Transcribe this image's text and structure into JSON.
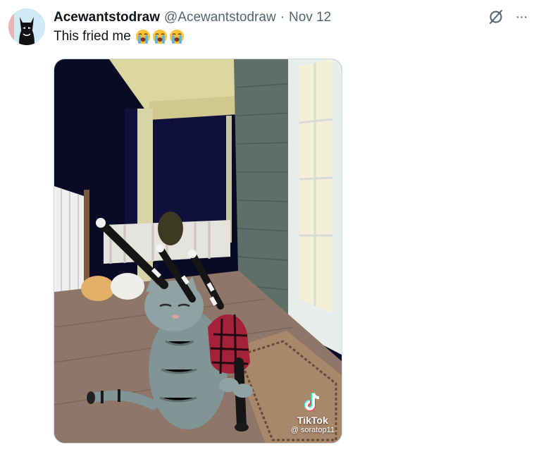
{
  "post": {
    "display_name": "Acewantstodraw",
    "handle": "@Acewantstodraw",
    "separator": "·",
    "date": "Nov 12",
    "text": "This fried me",
    "emojis": [
      "loudly-crying-face",
      "loudly-crying-face",
      "loudly-crying-face"
    ]
  },
  "actions": {
    "grok_icon": "grok-icon",
    "more_icon": "more-icon",
    "more_label": "···"
  },
  "media": {
    "watermark_brand": "TikTok",
    "watermark_user": "@ soratop11",
    "colors": {
      "night": "#0b0a26",
      "porch_ceiling": "#dcd6a0",
      "siding": "#5d6f66",
      "floor": "#8e7768"
    }
  }
}
